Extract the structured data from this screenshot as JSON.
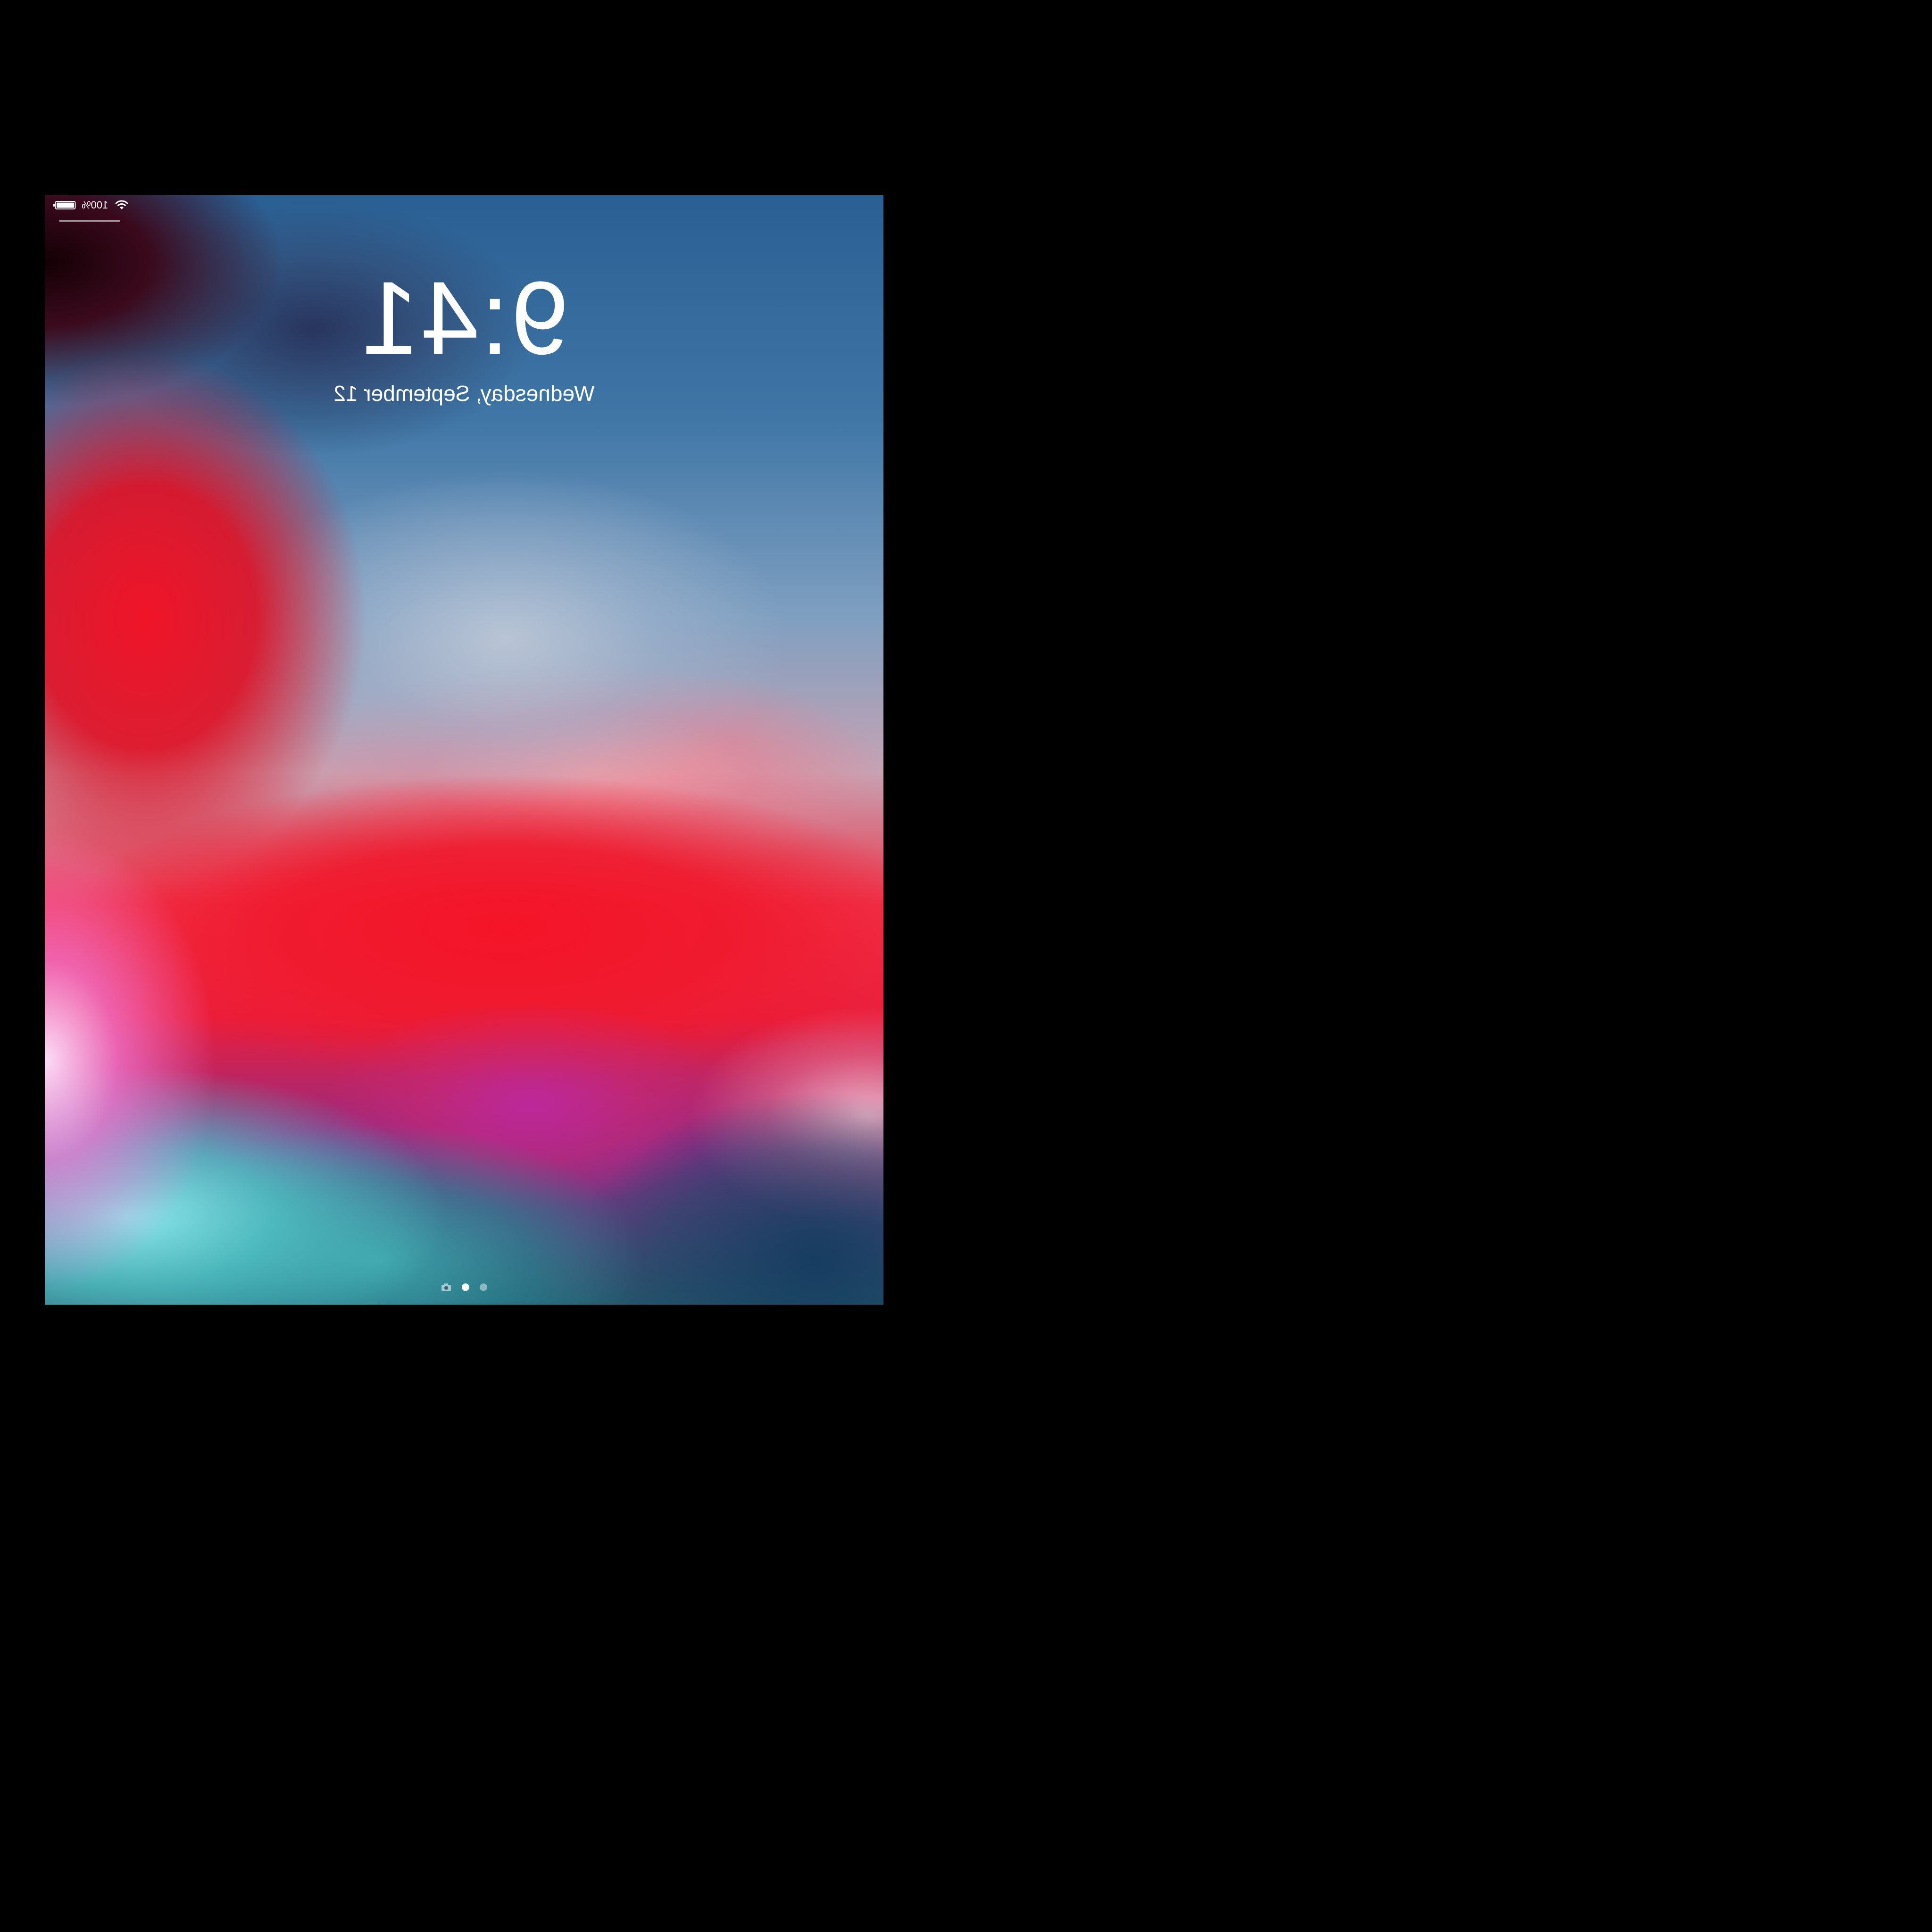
{
  "status_bar": {
    "battery_percent_text": "100%",
    "battery_level": 1.0,
    "battery_icon": "battery-icon",
    "wifi_icon": "wifi-icon"
  },
  "lock_screen": {
    "time": "9:41",
    "date": "Wednesday, September 12"
  },
  "page_indicator": {
    "icons": [
      "camera-icon"
    ],
    "pages": 2,
    "active_page": 1
  },
  "colors": {
    "background": "#000000",
    "text": "#ffffff",
    "wallpaper_blue": "#2a5f93",
    "wallpaper_red": "#ea1e3c",
    "wallpaper_teal": "#5cc9c9",
    "wallpaper_magenta": "#c0289a"
  }
}
